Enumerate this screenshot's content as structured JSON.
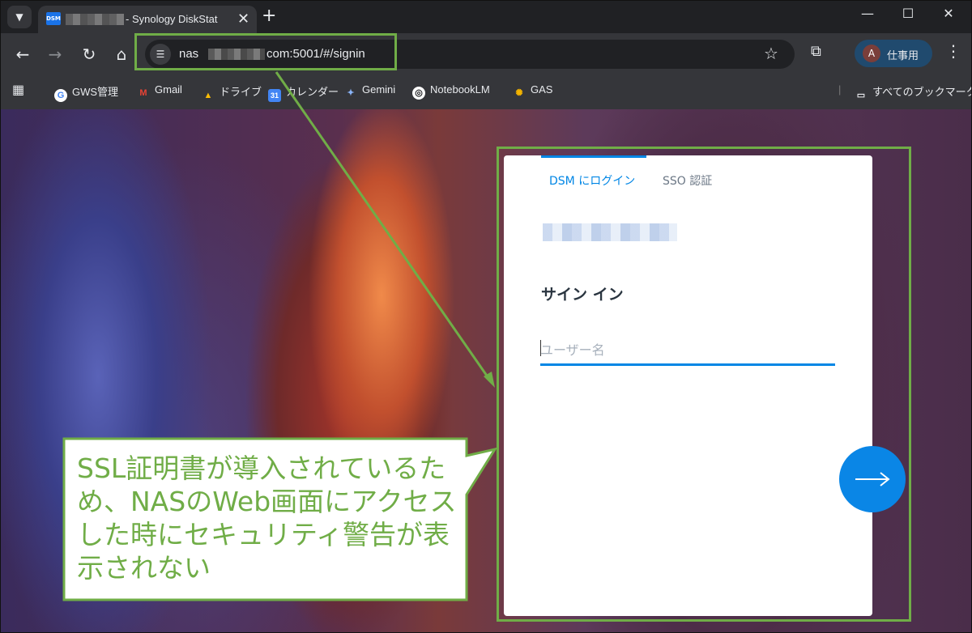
{
  "browser": {
    "tab": {
      "favicon_text": "DSM",
      "title": "- Synology DiskStat",
      "close_glyph": "✕"
    },
    "new_tab_glyph": "+",
    "window_controls": [
      "—",
      "☐",
      "✕"
    ],
    "address": {
      "url_prefix": "nas",
      "url_suffix": "com:5001/#/signin"
    },
    "profile": {
      "initial": "A",
      "name": "仕事用"
    },
    "bookmarks": [
      {
        "label": "GWS管理",
        "icon": "google-g-icon"
      },
      {
        "label": "Gmail",
        "icon": "gmail-icon"
      },
      {
        "label": "ドライブ",
        "icon": "drive-icon"
      },
      {
        "label": "カレンダー",
        "icon": "calendar-icon"
      },
      {
        "label": "Gemini",
        "icon": "gemini-icon"
      },
      {
        "label": "NotebookLM",
        "icon": "notebooklm-icon"
      },
      {
        "label": "GAS",
        "icon": "gas-icon"
      }
    ],
    "all_bookmarks_label": "すべてのブックマーク"
  },
  "login": {
    "tab_dsm": "DSM にログイン",
    "tab_sso": "SSO 認証",
    "heading": "サイン イン",
    "username_placeholder": "ユーザー名",
    "accent_color": "#0086e5"
  },
  "annotation": {
    "text": "SSL証明書が導入されているため、NASのWeb画面にアクセスした時にセキュリティ警告が表示されない",
    "color": "#70ad47"
  }
}
